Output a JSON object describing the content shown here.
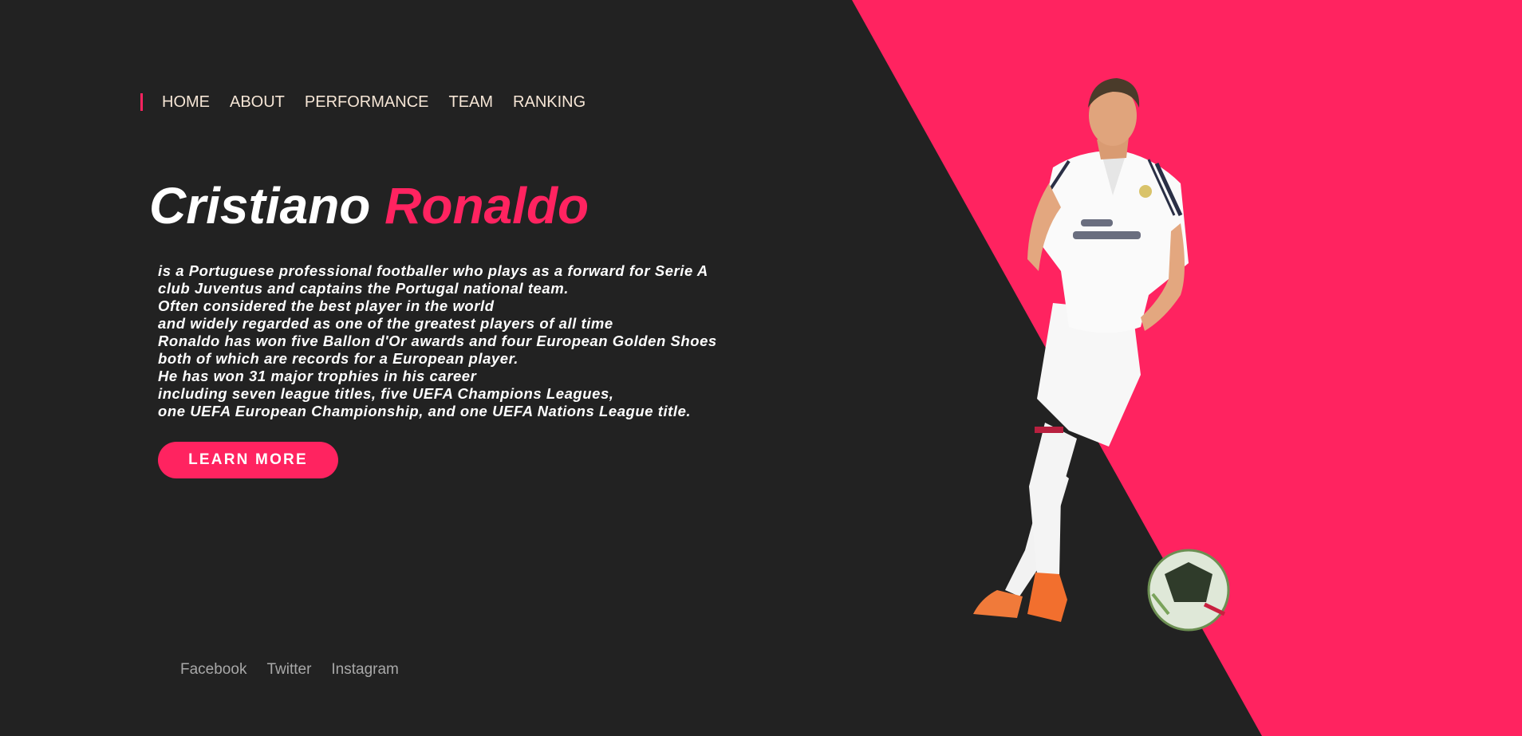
{
  "colors": {
    "background": "#222222",
    "accent": "#ff2360",
    "nav_text": "#f6e6d6",
    "social_text": "#a8a8a8"
  },
  "nav": {
    "items": [
      {
        "label": "HOME"
      },
      {
        "label": "ABOUT"
      },
      {
        "label": "PERFORMANCE"
      },
      {
        "label": "TEAM"
      },
      {
        "label": "RANKING"
      }
    ]
  },
  "hero": {
    "first_name": "Cristiano",
    "last_name": "Ronaldo",
    "description_lines": [
      "is a Portuguese professional footballer who plays as a forward for Serie A",
      "club Juventus and captains the Portugal national team.",
      "Often considered the best player in the world",
      "and widely regarded as one of the greatest players of all time",
      "Ronaldo has won five Ballon d'Or awards and four European Golden Shoes",
      "both of which are records for a European player.",
      "He has won 31 major trophies in his career",
      "including seven league titles, five UEFA Champions Leagues,",
      "one UEFA European Championship, and one UEFA Nations League title."
    ],
    "button_label": "LEARN MORE"
  },
  "socials": [
    {
      "label": "Facebook"
    },
    {
      "label": "Twitter"
    },
    {
      "label": "Instagram"
    }
  ],
  "images": {
    "player": "player-photo",
    "ball": "soccer-ball-icon"
  }
}
